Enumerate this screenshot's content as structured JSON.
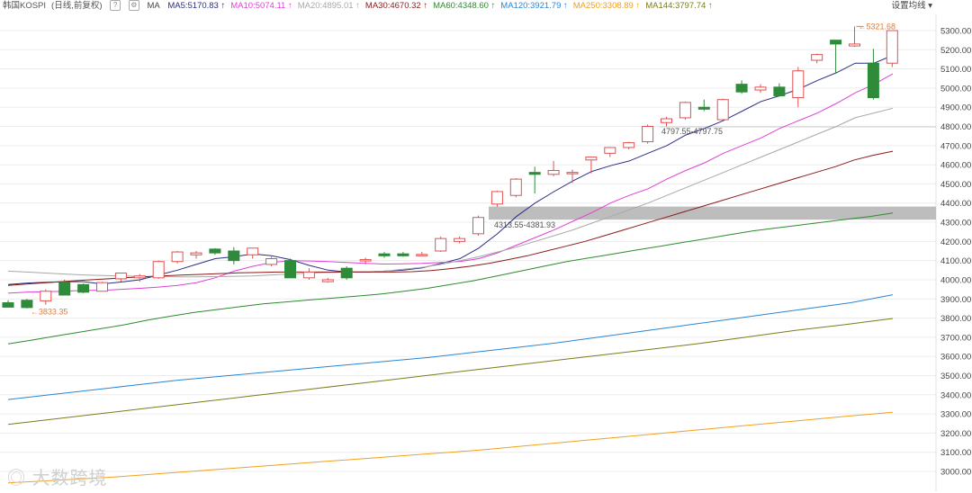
{
  "chart_data": {
    "type": "candlestick",
    "title": "韩国KOSPI",
    "subtitle": "(日线,前复权)",
    "indicator": "MA",
    "y_ticks": [
      3000,
      3100,
      3200,
      3300,
      3400,
      3500,
      3600,
      3700,
      3800,
      3900,
      4000,
      4100,
      4200,
      4300,
      4400,
      4500,
      4600,
      4700,
      4800,
      4900,
      5000,
      5100,
      5200,
      5300
    ],
    "ylim": [
      2980,
      5340
    ],
    "candles": [
      {
        "o": 3880,
        "h": 3893,
        "l": 3855,
        "c": 3857
      },
      {
        "o": 3893,
        "h": 3900,
        "l": 3850,
        "c": 3855
      },
      {
        "o": 3890,
        "h": 3950,
        "l": 3870,
        "c": 3940
      },
      {
        "o": 3985,
        "h": 4000,
        "l": 3960,
        "c": 3920
      },
      {
        "o": 3975,
        "h": 3980,
        "l": 3930,
        "c": 3935
      },
      {
        "o": 3940,
        "h": 3990,
        "l": 3940,
        "c": 3985
      },
      {
        "o": 4005,
        "h": 4035,
        "l": 3990,
        "c": 4035
      },
      {
        "o": 4010,
        "h": 4030,
        "l": 3990,
        "c": 4020
      },
      {
        "o": 4010,
        "h": 4100,
        "l": 4005,
        "c": 4095
      },
      {
        "o": 4095,
        "h": 4150,
        "l": 4085,
        "c": 4145
      },
      {
        "o": 4130,
        "h": 4150,
        "l": 4110,
        "c": 4140
      },
      {
        "o": 4160,
        "h": 4165,
        "l": 4130,
        "c": 4140
      },
      {
        "o": 4150,
        "h": 4170,
        "l": 4080,
        "c": 4100
      },
      {
        "o": 4130,
        "h": 4165,
        "l": 4110,
        "c": 4165
      },
      {
        "o": 4080,
        "h": 4120,
        "l": 4070,
        "c": 4110
      },
      {
        "o": 4100,
        "h": 4110,
        "l": 4010,
        "c": 4010
      },
      {
        "o": 4010,
        "h": 4060,
        "l": 4000,
        "c": 4040
      },
      {
        "o": 3990,
        "h": 4010,
        "l": 3985,
        "c": 4000
      },
      {
        "o": 4060,
        "h": 4070,
        "l": 4000,
        "c": 4010
      },
      {
        "o": 4100,
        "h": 4115,
        "l": 4080,
        "c": 4105
      },
      {
        "o": 4135,
        "h": 4145,
        "l": 4115,
        "c": 4125
      },
      {
        "o": 4135,
        "h": 4145,
        "l": 4120,
        "c": 4125
      },
      {
        "o": 4130,
        "h": 4145,
        "l": 4125,
        "c": 4132
      },
      {
        "o": 4150,
        "h": 4225,
        "l": 4145,
        "c": 4215
      },
      {
        "o": 4200,
        "h": 4225,
        "l": 4190,
        "c": 4215
      },
      {
        "o": 4240,
        "h": 4335,
        "l": 4230,
        "c": 4325
      },
      {
        "o": 4395,
        "h": 4465,
        "l": 4380,
        "c": 4460
      },
      {
        "o": 4440,
        "h": 4530,
        "l": 4430,
        "c": 4525
      },
      {
        "o": 4560,
        "h": 4590,
        "l": 4450,
        "c": 4550
      },
      {
        "o": 4550,
        "h": 4620,
        "l": 4540,
        "c": 4570
      },
      {
        "o": 4560,
        "h": 4575,
        "l": 4505,
        "c": 4560
      },
      {
        "o": 4625,
        "h": 4640,
        "l": 4555,
        "c": 4640
      },
      {
        "o": 4660,
        "h": 4690,
        "l": 4640,
        "c": 4690
      },
      {
        "o": 4690,
        "h": 4720,
        "l": 4680,
        "c": 4715
      },
      {
        "o": 4720,
        "h": 4810,
        "l": 4710,
        "c": 4800
      },
      {
        "o": 4820,
        "h": 4850,
        "l": 4800,
        "c": 4840
      },
      {
        "o": 4845,
        "h": 4930,
        "l": 4835,
        "c": 4925
      },
      {
        "o": 4900,
        "h": 4940,
        "l": 4880,
        "c": 4890
      },
      {
        "o": 4835,
        "h": 4945,
        "l": 4830,
        "c": 4940
      },
      {
        "o": 5020,
        "h": 5040,
        "l": 4970,
        "c": 4980
      },
      {
        "o": 4990,
        "h": 5020,
        "l": 4975,
        "c": 5005
      },
      {
        "o": 5005,
        "h": 5025,
        "l": 4955,
        "c": 4960
      },
      {
        "o": 4950,
        "h": 5110,
        "l": 4900,
        "c": 5090
      },
      {
        "o": 5145,
        "h": 5180,
        "l": 5130,
        "c": 5175
      },
      {
        "o": 5250,
        "h": 5250,
        "l": 5075,
        "c": 5230
      },
      {
        "o": 5220,
        "h": 5322,
        "l": 5215,
        "c": 5230
      },
      {
        "o": 5130,
        "h": 5205,
        "l": 4940,
        "c": 4950
      },
      {
        "o": 5130,
        "h": 5300,
        "l": 5110,
        "c": 5300
      }
    ],
    "series": [
      {
        "name": "MA5",
        "value": "5170.83",
        "color": "#2b2d84",
        "points": [
          3975,
          3983,
          3987,
          3990,
          3990,
          3978,
          3988,
          4000,
          4025,
          4050,
          4080,
          4110,
          4120,
          4135,
          4125,
          4105,
          4075,
          4050,
          4040,
          4040,
          4045,
          4050,
          4062,
          4085,
          4110,
          4165,
          4240,
          4330,
          4400,
          4460,
          4515,
          4565,
          4595,
          4620,
          4660,
          4700,
          4755,
          4790,
          4830,
          4880,
          4930,
          4960,
          4995,
          5040,
          5080,
          5130,
          5130,
          5170.83
        ]
      },
      {
        "name": "MA10",
        "value": "5074.11",
        "color": "#e040d8",
        "points": [
          3930,
          3935,
          3938,
          3940,
          3945,
          3945,
          3950,
          3955,
          3962,
          3970,
          3985,
          4010,
          4045,
          4070,
          4090,
          4100,
          4098,
          4095,
          4090,
          4085,
          4082,
          4083,
          4085,
          4090,
          4095,
          4110,
          4140,
          4180,
          4220,
          4260,
          4305,
          4350,
          4400,
          4440,
          4475,
          4525,
          4570,
          4610,
          4660,
          4700,
          4740,
          4790,
          4830,
          4870,
          4920,
          4975,
          5020,
          5074.11
        ]
      },
      {
        "name": "MA20",
        "value": "4895.01",
        "color": "#a8a8a8",
        "points": [
          4045,
          4040,
          4035,
          4030,
          4025,
          4022,
          4020,
          4018,
          4016,
          4015,
          4015,
          4016,
          4018,
          4020,
          4025,
          4030,
          4035,
          4038,
          4040,
          4042,
          4045,
          4055,
          4065,
          4080,
          4100,
          4120,
          4145,
          4170,
          4200,
          4230,
          4260,
          4295,
          4330,
          4365,
          4400,
          4440,
          4480,
          4520,
          4560,
          4600,
          4640,
          4680,
          4720,
          4760,
          4800,
          4845,
          4870,
          4895.01
        ]
      },
      {
        "name": "MA30",
        "value": "4670.32",
        "color": "#8b1a1a",
        "points": [
          3970,
          3978,
          3985,
          3992,
          3998,
          4004,
          4010,
          4015,
          4020,
          4024,
          4028,
          4032,
          4036,
          4038,
          4040,
          4040,
          4040,
          4040,
          4040,
          4040,
          4040,
          4042,
          4048,
          4058,
          4070,
          4085,
          4105,
          4125,
          4150,
          4175,
          4200,
          4230,
          4260,
          4290,
          4320,
          4350,
          4380,
          4410,
          4440,
          4470,
          4500,
          4530,
          4560,
          4590,
          4625,
          4650,
          4670.32
        ]
      },
      {
        "name": "MA60",
        "value": "4348.60",
        "color": "#2e8b2e",
        "points": [
          3665,
          3685,
          3705,
          3725,
          3745,
          3765,
          3790,
          3810,
          3830,
          3845,
          3860,
          3875,
          3885,
          3895,
          3905,
          3915,
          3925,
          3940,
          3955,
          3975,
          3995,
          4020,
          4045,
          4070,
          4095,
          4115,
          4135,
          4155,
          4175,
          4195,
          4215,
          4235,
          4255,
          4270,
          4285,
          4300,
          4315,
          4330,
          4348.6
        ]
      },
      {
        "name": "MA120",
        "value": "3921.79",
        "color": "#2a86d4",
        "points": [
          3375,
          3400,
          3425,
          3450,
          3475,
          3495,
          3515,
          3535,
          3555,
          3575,
          3595,
          3620,
          3645,
          3670,
          3700,
          3730,
          3760,
          3790,
          3820,
          3850,
          3880,
          3921.79
        ]
      },
      {
        "name": "MA250",
        "value": "3308.89",
        "color": "#f0a020",
        "points": [
          2940,
          2955,
          2970,
          2990,
          3010,
          3030,
          3050,
          3070,
          3090,
          3110,
          3135,
          3160,
          3185,
          3210,
          3235,
          3260,
          3285,
          3308.89
        ]
      },
      {
        "name": "MA144",
        "value": "3797.74",
        "color": "#7c7c1c",
        "points": [
          3245,
          3275,
          3305,
          3335,
          3365,
          3395,
          3425,
          3455,
          3485,
          3515,
          3545,
          3575,
          3605,
          3635,
          3665,
          3700,
          3735,
          3765,
          3797.74
        ]
      }
    ],
    "annotations": {
      "high_label": "5321.68",
      "low_label": "3833.35",
      "zone1_label": "4313.55-4381.93",
      "zone1_range": [
        4313.55,
        4381.93
      ],
      "zone2_label": "4797.55-4797.75",
      "zone2_value": 4797.65
    }
  },
  "ui": {
    "title": "韩国KOSPI",
    "subtitle": "(日线,前复权)",
    "help_icon_label": "?",
    "indicator": "MA",
    "settings_label": "设置均线",
    "watermark": "大数跨境"
  }
}
